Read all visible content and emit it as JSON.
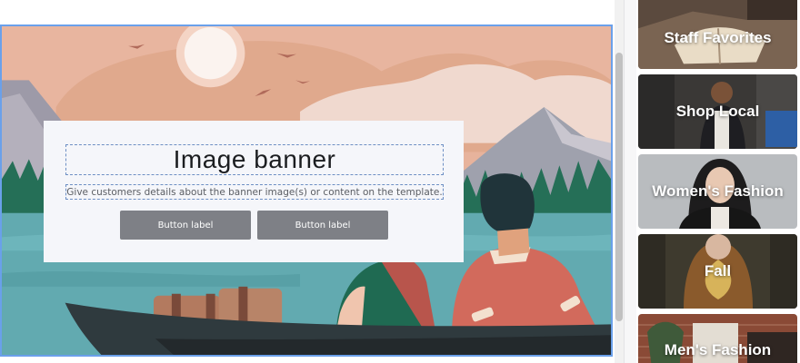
{
  "banner": {
    "heading": "Image banner",
    "description": "Give customers details about the banner image(s) or content on the template.",
    "buttons": [
      {
        "label": "Button label"
      },
      {
        "label": "Button label"
      }
    ]
  },
  "templates": [
    {
      "label": "Staff Favorites"
    },
    {
      "label": "Shop Local"
    },
    {
      "label": "Women's Fashion"
    },
    {
      "label": "Fall"
    },
    {
      "label": "Men's Fashion"
    }
  ],
  "colors": {
    "selection_outline": "#6aa0ea",
    "button_bg": "#7e8086",
    "content_box_bg": "#f5f6fa"
  }
}
